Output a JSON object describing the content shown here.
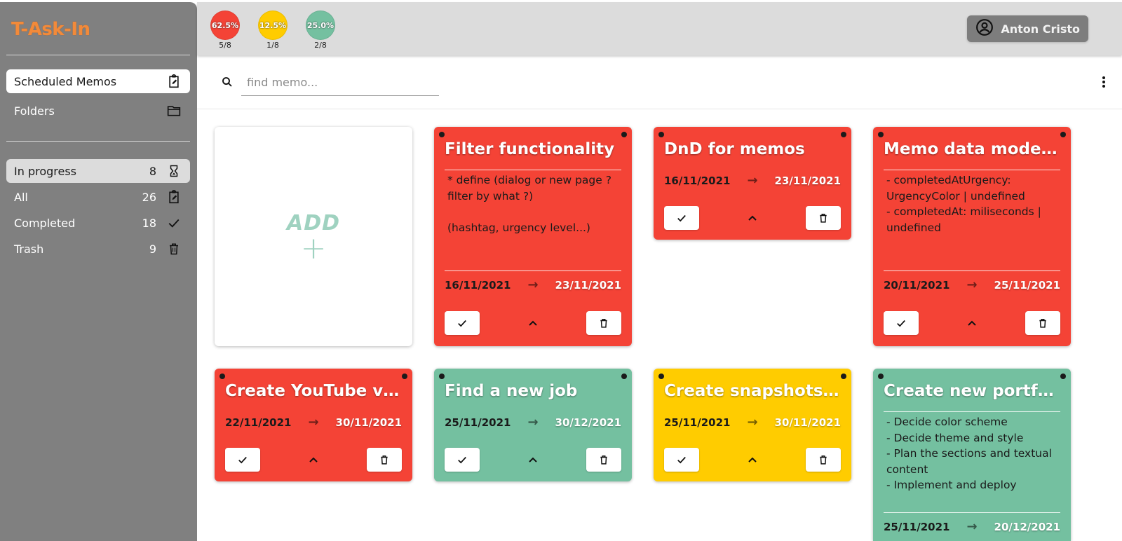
{
  "app": {
    "logo": "T-Ask-In"
  },
  "sidebar": {
    "nav": [
      {
        "label": "Scheduled Memos",
        "icon": "clipboard-edit-icon"
      },
      {
        "label": "Folders",
        "icon": "folder-icon"
      }
    ],
    "filters": [
      {
        "label": "In progress",
        "count": "8",
        "icon": "hourglass-icon"
      },
      {
        "label": "All",
        "count": "26",
        "icon": "clipboard-edit-icon"
      },
      {
        "label": "Completed",
        "count": "18",
        "icon": "check-icon"
      },
      {
        "label": "Trash",
        "count": "9",
        "icon": "trash-icon"
      }
    ]
  },
  "header": {
    "stats": [
      {
        "percent": "62.5%",
        "fraction": "5/8",
        "color": "#f44336"
      },
      {
        "percent": "12.5%",
        "fraction": "1/8",
        "color": "#ffcc00"
      },
      {
        "percent": "25.0%",
        "fraction": "2/8",
        "color": "#74c0a0"
      }
    ],
    "user": {
      "name": "Anton Cristo",
      "icon": "account-circle-icon"
    }
  },
  "search": {
    "placeholder": "find memo...",
    "value": ""
  },
  "colors": {
    "red": "#f44336",
    "yellow": "#ffcc00",
    "green": "#74c0a0",
    "sidebar": "#808080",
    "logo": "#f28a3a"
  },
  "add_card": {
    "label": "ADD",
    "plus": "+"
  },
  "memos": [
    {
      "title": "Filter functionality",
      "description": "* define (dialog or new page ?\nfilter by what ?)\n\n(hashtag, urgency level...)\n\n@@ decide if color map",
      "start": "16/11/2021",
      "end": "23/11/2021",
      "color": "#f44336"
    },
    {
      "title": "DnD for memos",
      "description": "",
      "start": "16/11/2021",
      "end": "23/11/2021",
      "color": "#f44336"
    },
    {
      "title": "Memo data model ...",
      "description": "- completedAtUrgency:\nUrgencyColor | undefined\n- completedAt: miliseconds |\nundefined\n\n* edge cases:",
      "start": "20/11/2021",
      "end": "25/11/2021",
      "color": "#f44336"
    },
    {
      "title": "Create YouTube vi...",
      "description": "",
      "start": "22/11/2021",
      "end": "30/11/2021",
      "color": "#f44336"
    },
    {
      "title": "Find a new job",
      "description": "",
      "start": "25/11/2021",
      "end": "30/12/2021",
      "color": "#74c0a0"
    },
    {
      "title": "Create snapshots ...",
      "description": "",
      "start": "25/11/2021",
      "end": "30/11/2021",
      "color": "#ffcc00"
    },
    {
      "title": "Create new portfolio",
      "description": "- Decide color scheme\n- Decide theme and style\n- Plan the sections and textual\ncontent\n- Implement and deploy",
      "start": "25/11/2021",
      "end": "20/12/2021",
      "color": "#74c0a0"
    }
  ],
  "arrow": "→"
}
